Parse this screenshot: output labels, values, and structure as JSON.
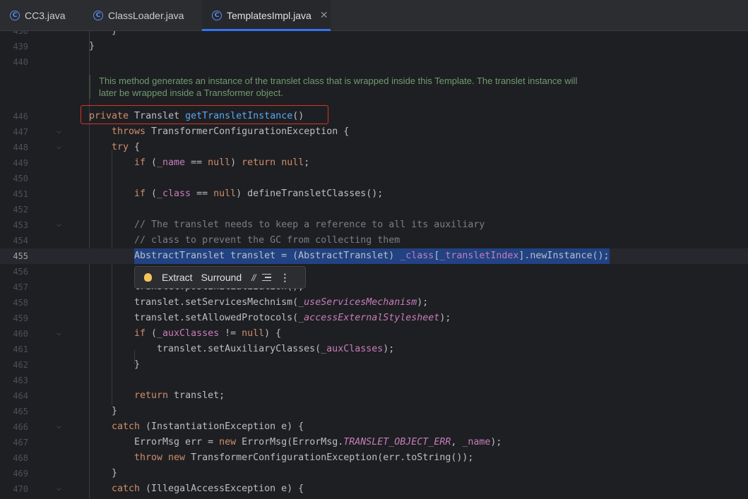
{
  "tabs": [
    {
      "label": "CC3.java",
      "icon": "java-class-icon"
    },
    {
      "label": "ClassLoader.java",
      "icon": "java-class-icon"
    },
    {
      "label": "TemplatesImpl.java",
      "icon": "java-class-icon",
      "active": true
    }
  ],
  "doc_comment": "This method generates an instance of the translet class that is wrapped inside this Template. The translet instance will later be wrapped inside a Transformer object.",
  "line_numbers": {
    "l438": "438",
    "l439": "439",
    "l440": "440",
    "l446": "446",
    "l447": "447",
    "l448": "448",
    "l449": "449",
    "l450": "450",
    "l451": "451",
    "l452": "452",
    "l453": "453",
    "l454": "454",
    "l455": "455",
    "l456": "456",
    "l457": "457",
    "l458": "458",
    "l459": "459",
    "l460": "460",
    "l461": "461",
    "l462": "462",
    "l463": "463",
    "l464": "464",
    "l465": "465",
    "l466": "466",
    "l467": "467",
    "l468": "468",
    "l469": "469",
    "l470": "470"
  },
  "code": {
    "l438": "}",
    "l439": "}",
    "l446": {
      "t1": "private",
      "t2": " Translet ",
      "t3": "getTransletInstance",
      "t4": "()"
    },
    "l447": {
      "t1": "throws",
      "t2": " TransformerConfigurationException {"
    },
    "l448": {
      "t1": "try",
      "t2": " {"
    },
    "l449": {
      "t1": "if",
      "t2": " (",
      "t3": "_name",
      "t4": " == ",
      "t5": "null",
      "t6": ") ",
      "t7": "return",
      "t8": " ",
      "t9": "null",
      "t10": ";"
    },
    "l451": {
      "t1": "if",
      "t2": " (",
      "t3": "_class",
      "t4": " == ",
      "t5": "null",
      "t6": ") defineTransletClasses();"
    },
    "l453": "// The translet needs to keep a reference to all its auxiliary",
    "l454": "// class to prevent the GC from collecting them",
    "l455": {
      "t1": "AbstractTranslet translet = (AbstractTranslet) ",
      "t2": "_class",
      "t3": "[",
      "t4": "_transletIndex",
      "t5": "].newInstance();"
    },
    "l457": "translet.postInitialization();",
    "l458": {
      "t1": "translet.setServicesMechnism(",
      "t2": "_useServicesMechanism",
      "t3": ");"
    },
    "l459": {
      "t1": "translet.setAllowedProtocols(",
      "t2": "_accessExternalStylesheet",
      "t3": ");"
    },
    "l460": {
      "t1": "if",
      "t2": " (",
      "t3": "_auxClasses",
      "t4": " != ",
      "t5": "null",
      "t6": ") {"
    },
    "l461": {
      "t1": "translet.setAuxiliaryClasses(",
      "t2": "_auxClasses",
      "t3": ");"
    },
    "l462": "}",
    "l464": {
      "t1": "return",
      "t2": " translet;"
    },
    "l465": "}",
    "l466": {
      "t1": "catch",
      "t2": " (InstantiationException e) {"
    },
    "l467": {
      "t1": "ErrorMsg err = ",
      "t2": "new",
      "t3": " ErrorMsg(ErrorMsg.",
      "t4": "TRANSLET_OBJECT_ERR",
      "t5": ", ",
      "t6": "_name",
      "t7": ");"
    },
    "l468": {
      "t1": "throw",
      "t2": " ",
      "t3": "new",
      "t4": " TransformerConfigurationException(err.toString());"
    },
    "l469": "}",
    "l470": {
      "t1": "catch",
      "t2": " (IllegalAccessException e) {"
    }
  },
  "popup": {
    "extract_label": "Extract",
    "surround_label": "Surround",
    "comment_label": "//"
  },
  "icons": {
    "fold": "chevron-down-icon",
    "bulb": "lightbulb-icon",
    "format": "reformat-icon",
    "more": "more-vertical-icon"
  },
  "colors": {
    "keyword": "#cf8e6d",
    "method": "#56a8f5",
    "field": "#c77dbb",
    "comment": "#7a7e85",
    "selection": "#214283",
    "tab_accent": "#3574f0",
    "annotation_box": "#d2362a"
  }
}
